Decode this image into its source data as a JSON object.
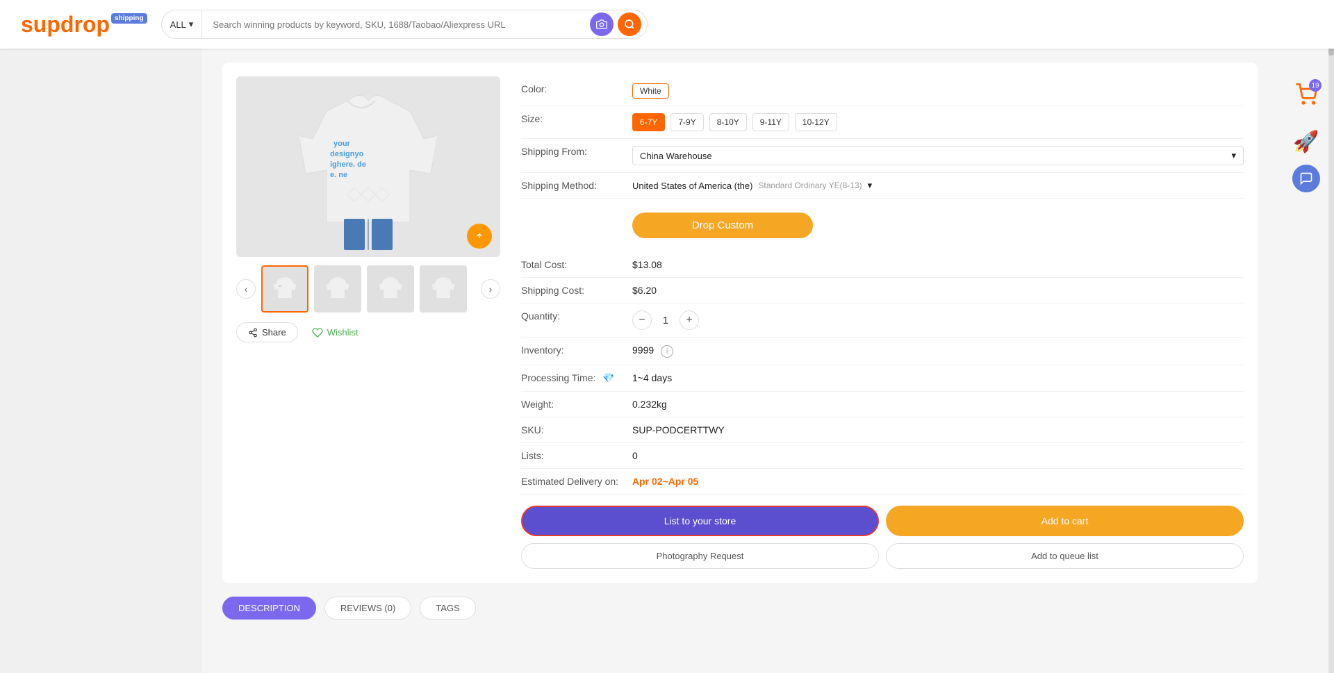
{
  "header": {
    "logo_sup": "sup",
    "logo_drop": "drop",
    "logo_shipping": "shipping",
    "search_placeholder": "Search winning products by keyword, SKU, 1688/Taobao/Aliexpress URL",
    "search_all_label": "ALL"
  },
  "product": {
    "color_label": "Color:",
    "color_selected": "White",
    "size_label": "Size:",
    "sizes": [
      "6-7Y",
      "7-9Y",
      "8-10Y",
      "9-11Y",
      "10-12Y"
    ],
    "size_selected": "6-7Y",
    "shipping_from_label": "Shipping From:",
    "shipping_from": "China Warehouse",
    "shipping_method_label": "Shipping Method:",
    "shipping_country": "United States of America (the)",
    "shipping_method": "Standard Ordinary YE(8-13)",
    "drop_custom_btn": "Drop Custom",
    "total_cost_label": "Total Cost:",
    "total_cost": "$13.08",
    "shipping_cost_label": "Shipping Cost:",
    "shipping_cost": "$6.20",
    "quantity_label": "Quantity:",
    "quantity_value": "1",
    "inventory_label": "Inventory:",
    "inventory_value": "9999",
    "processing_time_label": "Processing Time:",
    "processing_time": "1~4 days",
    "weight_label": "Weight:",
    "weight": "0.232kg",
    "sku_label": "SKU:",
    "sku": "SUP-PODCERTTWY",
    "lists_label": "Lists:",
    "lists_value": "0",
    "delivery_label": "Estimated Delivery on:",
    "delivery_value": "Apr 02~Apr 05",
    "list_store_btn": "List to your store",
    "add_cart_btn": "Add to cart",
    "photo_request_btn": "Photography Request",
    "add_queue_btn": "Add to queue list",
    "share_btn": "Share",
    "wishlist_btn": "Wishlist"
  },
  "tabs": {
    "description": "DESCRIPTION",
    "reviews": "REVIEWS (0)",
    "tags": "TAGS"
  },
  "cart": {
    "badge": "19"
  },
  "thumbnails": [
    {
      "id": 1,
      "active": true
    },
    {
      "id": 2,
      "active": false
    },
    {
      "id": 3,
      "active": false
    },
    {
      "id": 4,
      "active": false
    }
  ]
}
